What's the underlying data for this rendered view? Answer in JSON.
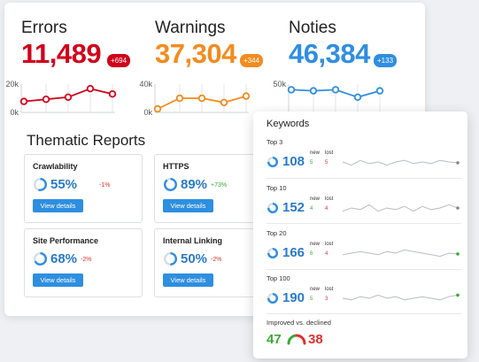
{
  "metrics": [
    {
      "title": "Errors",
      "value": "11,489",
      "badge": "+694",
      "color": "#d0021b",
      "y_top": "20k",
      "y_bottom": "0k",
      "trend": [
        0.35,
        0.45,
        0.55,
        0.95,
        0.7
      ]
    },
    {
      "title": "Warnings",
      "value": "37,304",
      "badge": "+344",
      "color": "#f28c1e",
      "y_top": "40k",
      "y_bottom": "0k",
      "trend": [
        0.0,
        0.5,
        0.5,
        0.3,
        0.6
      ]
    },
    {
      "title": "Noties",
      "value": "46,384",
      "badge": "+133",
      "color": "#2f8ee0",
      "y_top": "50k",
      "y_bottom": "",
      "trend": [
        0.9,
        0.85,
        0.9,
        0.55,
        0.85
      ]
    }
  ],
  "thematic": {
    "title": "Thematic Reports",
    "button_label": "View details",
    "cards": [
      {
        "name": "Crawlability",
        "value": "55%",
        "delta": "-1%",
        "delta_color": "#e0302b",
        "fraction": 0.55
      },
      {
        "name": "HTTPS",
        "value": "89%",
        "delta": "+73%",
        "delta_color": "#3aaa35",
        "fraction": 0.89
      },
      {
        "name": "Site Performance",
        "value": "68%",
        "delta": "-2%",
        "delta_color": "#e0302b",
        "fraction": 0.68
      },
      {
        "name": "Internal Linking",
        "value": "50%",
        "delta": "-2%",
        "delta_color": "#e0302b",
        "fraction": 0.5
      }
    ]
  },
  "keywords": {
    "title": "Keywords",
    "new_label": "new",
    "lost_label": "lost",
    "rows": [
      {
        "label": "Top 3",
        "value": "108",
        "new": "5",
        "lost": "5",
        "end_color": "#888888",
        "spark": [
          0.5,
          0.3,
          0.6,
          0.4,
          0.5,
          0.3,
          0.5,
          0.6,
          0.4,
          0.5,
          0.4,
          0.6,
          0.5,
          0.45
        ]
      },
      {
        "label": "Top 10",
        "value": "152",
        "new": "4",
        "lost": "4",
        "end_color": "#888888",
        "spark": [
          0.3,
          0.5,
          0.4,
          0.7,
          0.3,
          0.5,
          0.4,
          0.6,
          0.3,
          0.6,
          0.4,
          0.5,
          0.7,
          0.5
        ]
      },
      {
        "label": "Top 20",
        "value": "166",
        "new": "6",
        "lost": "4",
        "end_color": "#3aaa35",
        "spark": [
          0.4,
          0.5,
          0.6,
          0.5,
          0.4,
          0.6,
          0.5,
          0.7,
          0.6,
          0.5,
          0.4,
          0.3,
          0.5,
          0.45
        ]
      },
      {
        "label": "Top 100",
        "value": "190",
        "new": "5",
        "lost": "3",
        "end_color": "#3aaa35",
        "spark": [
          0.5,
          0.4,
          0.6,
          0.5,
          0.7,
          0.5,
          0.6,
          0.4,
          0.5,
          0.6,
          0.5,
          0.4,
          0.6,
          0.7
        ]
      }
    ],
    "improved_label": "Improved vs. declined",
    "improved": "47",
    "declined": "38"
  },
  "colors": {
    "blue": "#2f8ee0",
    "green": "#3aaa35",
    "red": "#e0302b",
    "orange": "#f28c1e"
  }
}
